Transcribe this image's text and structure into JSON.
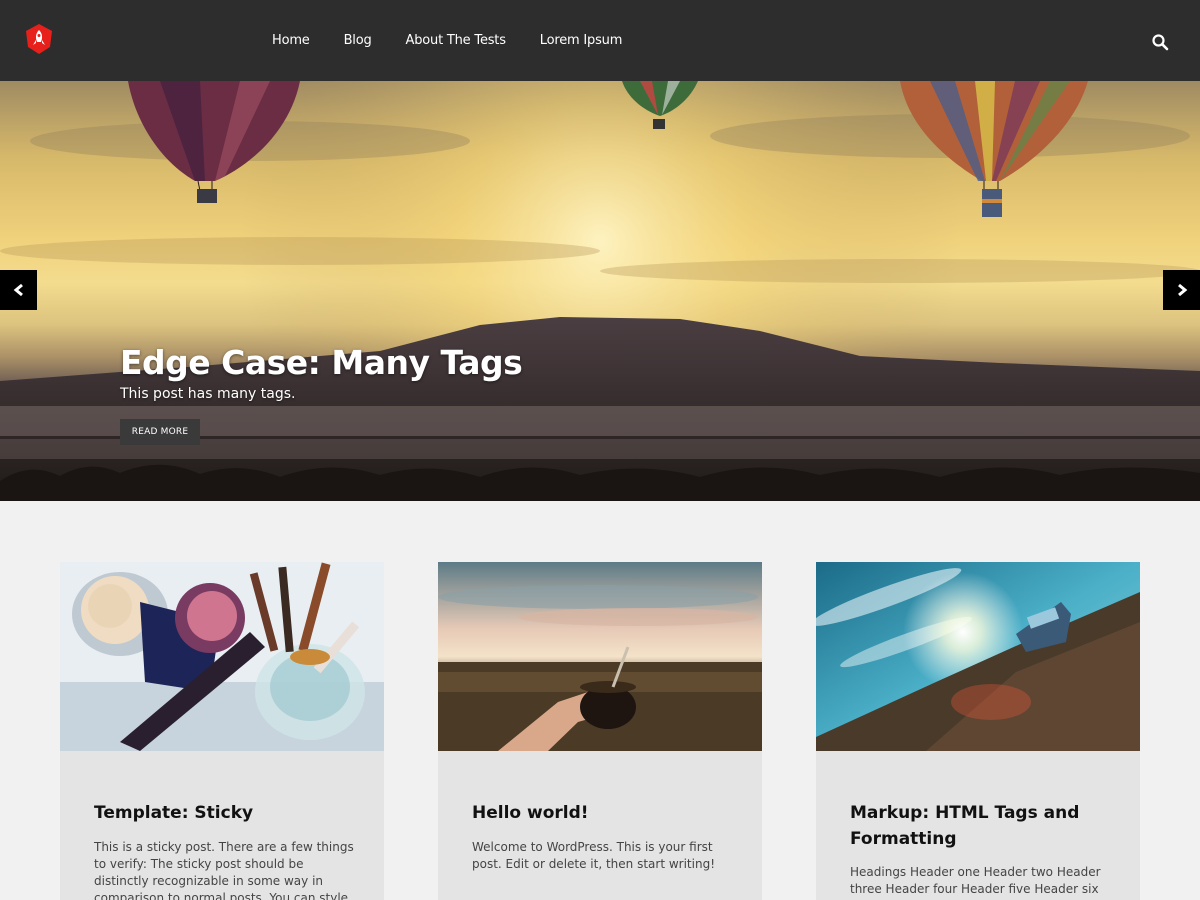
{
  "header": {
    "nav": [
      "Home",
      "Blog",
      "About The Tests",
      "Lorem Ipsum"
    ]
  },
  "hero": {
    "title": "Edge Case: Many Tags",
    "subtitle": "This post has many tags.",
    "button": "READ MORE"
  },
  "icons": {
    "logo": "rocket-shield-icon",
    "search": "search-icon",
    "prev": "chevron-left-icon",
    "next": "chevron-right-icon"
  },
  "colors": {
    "header_bg": "#2d2d2d",
    "logo_red": "#e8201b",
    "page_bg": "#f1f1f1",
    "card_bg": "#e4e4e4"
  },
  "cards": [
    {
      "title": "Template: Sticky",
      "excerpt": "This is a sticky post. There are a few things to verify: The sticky post should be distinctly recognizable in some way in comparison to normal posts. You can style the .sticky class if"
    },
    {
      "title": "Hello world!",
      "excerpt": "Welcome to WordPress. This is your first post. Edit or delete it, then start writing!"
    },
    {
      "title": "Markup: HTML Tags and Formatting",
      "excerpt": "Headings Header one Header two Header three Header four Header five Header six Blockquotes"
    }
  ]
}
